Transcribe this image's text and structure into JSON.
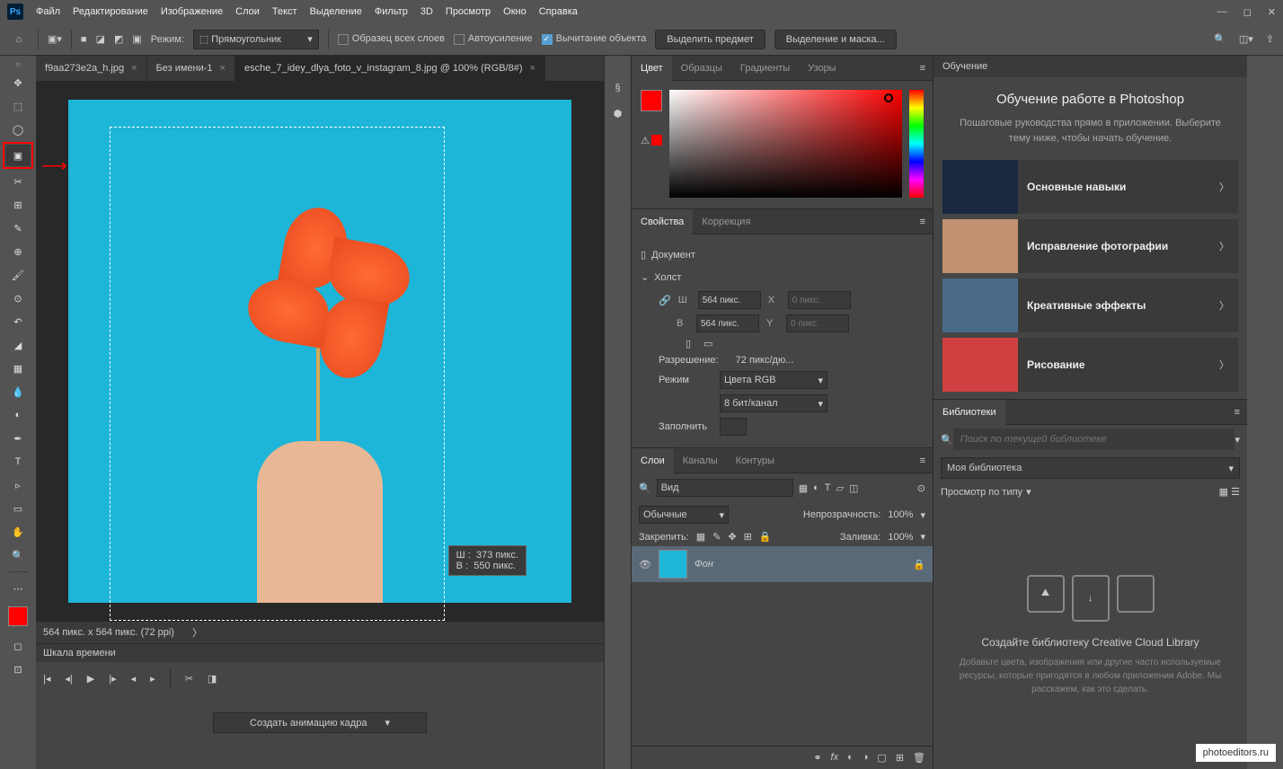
{
  "menu": {
    "file": "Файл",
    "edit": "Редактирование",
    "image": "Изображение",
    "layers": "Слои",
    "text": "Текст",
    "select": "Выделение",
    "filter": "Фильтр",
    "d3": "3D",
    "view": "Просмотр",
    "window": "Окно",
    "help": "Справка"
  },
  "optbar": {
    "mode_label": "Режим:",
    "mode_value": "Прямоугольник",
    "sample_all": "Образец всех слоев",
    "auto_enhance": "Автоусиление",
    "subtract": "Вычитание объекта",
    "select_subject": "Выделить предмет",
    "select_mask": "Выделение и маска..."
  },
  "tabs": [
    {
      "name": "f9aa273e2a_h.jpg",
      "active": false
    },
    {
      "name": "Без имени-1",
      "active": false
    },
    {
      "name": "esche_7_idey_dlya_foto_v_instagram_8.jpg @ 100% (RGB/8#)",
      "active": true
    }
  ],
  "selection_info": {
    "w_label": "Ш :",
    "w": "373 пикс.",
    "h_label": "В :",
    "h": "550 пикс."
  },
  "status": "564 пикс. x 564 пикс. (72 ppi)",
  "timeline": {
    "title": "Шкала времени",
    "create": "Создать анимацию кадра"
  },
  "color_panel": {
    "tabs": [
      "Цвет",
      "Образцы",
      "Градиенты",
      "Узоры"
    ]
  },
  "props": {
    "tabs": [
      "Свойства",
      "Коррекция"
    ],
    "doc": "Документ",
    "canvas": "Холст",
    "w_label": "Ш",
    "w": "564 пикс.",
    "x_label": "X",
    "x": "0 пикс.",
    "h_label": "В",
    "h": "564 пикс.",
    "y_label": "Y",
    "y": "0 пикс.",
    "res_label": "Разрешение:",
    "res": "72 пикс/дю...",
    "mode_label": "Режим",
    "mode": "Цвета RGB",
    "depth": "8 бит/канал",
    "fill_label": "Заполнить"
  },
  "layers": {
    "tabs": [
      "Слои",
      "Каналы",
      "Контуры"
    ],
    "kind": "Вид",
    "blend": "Обычные",
    "opacity_label": "Непрозрачность:",
    "opacity": "100%",
    "lock_label": "Закрепить:",
    "fill_label": "Заливка:",
    "fill": "100%",
    "layer_name": "Фон"
  },
  "learn": {
    "tab": "Обучение",
    "title": "Обучение работе в Photoshop",
    "desc": "Пошаговые руководства прямо в приложении. Выберите тему ниже, чтобы начать обучение.",
    "items": [
      "Основные навыки",
      "Исправление фотографии",
      "Креативные эффекты",
      "Рисование"
    ]
  },
  "lib": {
    "tab": "Библиотеки",
    "search_ph": "Поиск по текущей библиотеке",
    "my_lib": "Моя библиотека",
    "view": "Просмотр по типу",
    "title": "Создайте библиотеку Creative Cloud Library",
    "desc": "Добавьте цвета, изображения или другие часто используемые ресурсы, которые пригодятся в любом приложении Adobe. Мы расскажем, как это сделать."
  },
  "watermark": "photoeditors.ru"
}
